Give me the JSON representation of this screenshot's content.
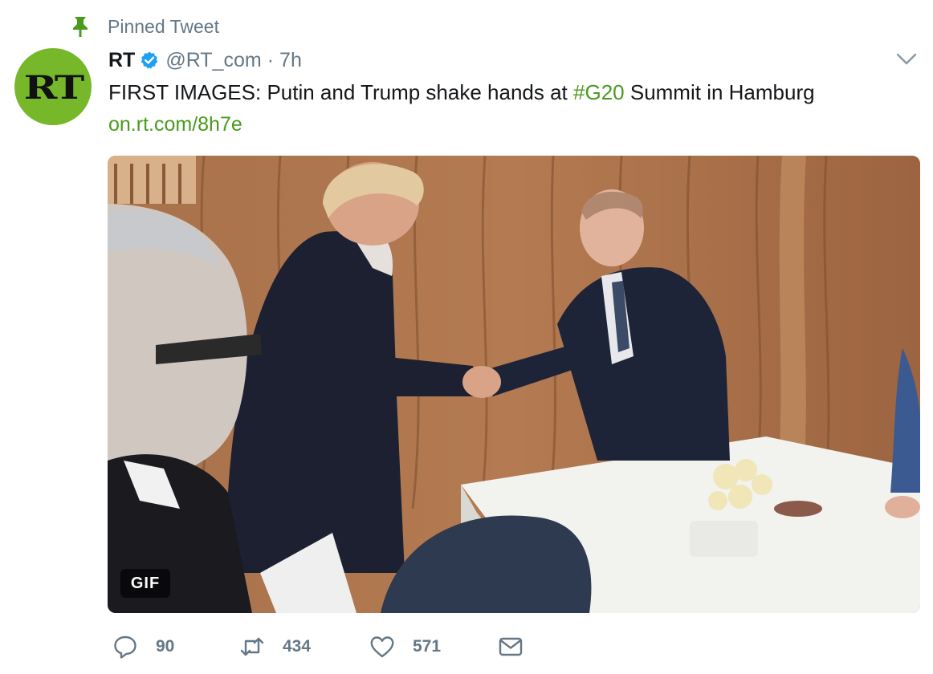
{
  "pinned_label": "Pinned Tweet",
  "author": {
    "display_name": "RT",
    "handle": "@RT_com",
    "separator": "·",
    "time": "7h",
    "avatar_text": "RT",
    "verified": true
  },
  "tweet": {
    "text_before": "FIRST IMAGES: Putin and Trump shake hands at ",
    "hashtag": "#G20",
    "text_after": " Summit in Hamburg",
    "link": "on.rt.com/8h7e"
  },
  "media": {
    "badge": "GIF"
  },
  "actions": {
    "replies": "90",
    "retweets": "434",
    "likes": "571"
  },
  "colors": {
    "accent_green": "#4a9a1e",
    "avatar_green": "#76b82a",
    "secondary_text": "#657786",
    "verified_blue": "#1da1f2"
  }
}
